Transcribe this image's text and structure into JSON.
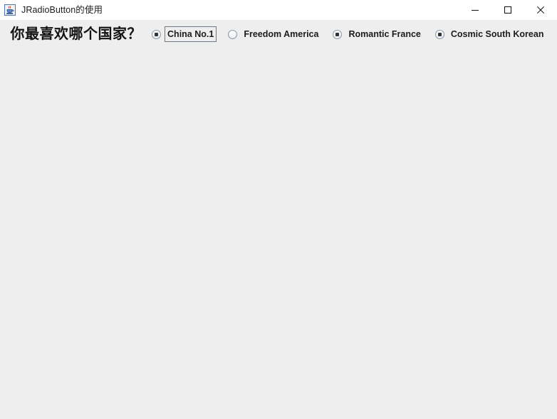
{
  "window": {
    "title": "JRadioButton的使用",
    "app_icon": "java-coffee-cup-icon",
    "background_color": "#eeeeee",
    "titlebar_color": "#ffffff"
  },
  "titlebar_buttons": [
    {
      "name": "minimize-button",
      "glyph": "minimize-icon",
      "label": "Minimize"
    },
    {
      "name": "maximize-button",
      "glyph": "maximize-icon",
      "label": "Maximize"
    },
    {
      "name": "close-button",
      "glyph": "close-icon",
      "label": "Close"
    }
  ],
  "main": {
    "question_label": "你最喜欢哪个国家？",
    "radio_group": {
      "name": "favorite-country-group",
      "options": [
        {
          "label": "China No.1",
          "selected": true,
          "focused": true
        },
        {
          "label": "Freedom America",
          "selected": false,
          "focused": false
        },
        {
          "label": "Romantic France",
          "selected": true,
          "focused": false
        },
        {
          "label": "Cosmic South Korean",
          "selected": true,
          "focused": false
        }
      ]
    }
  }
}
